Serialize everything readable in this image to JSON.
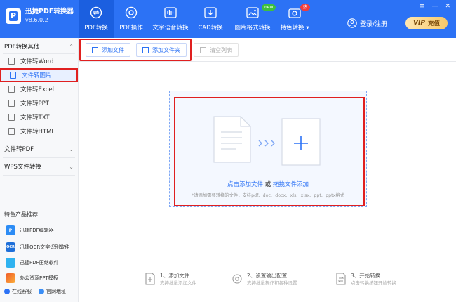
{
  "app": {
    "name": "迅捷PDF转换器",
    "version": "v8.6.0.2"
  },
  "nav": {
    "tabs": [
      {
        "label": "PDF转换",
        "active": true
      },
      {
        "label": "PDF操作"
      },
      {
        "label": "文字语音转换"
      },
      {
        "label": "CAD转换"
      },
      {
        "label": "图片格式转换",
        "badge": "new"
      },
      {
        "label": "特色转换",
        "badge": "热"
      }
    ]
  },
  "header": {
    "login_label": "登录/注册",
    "vip_mark": "VIP",
    "vip_label": "充值"
  },
  "window_controls": {
    "menu": "≡",
    "minimize": "—",
    "close": "✕"
  },
  "sidebar": {
    "section1": "PDF转换其他",
    "items": [
      {
        "label": "文件转Word"
      },
      {
        "label": "文件转图片",
        "active": true
      },
      {
        "label": "文件转Excel"
      },
      {
        "label": "文件转PPT"
      },
      {
        "label": "文件转TXT"
      },
      {
        "label": "文件转HTML"
      }
    ],
    "section2": "文件转PDF",
    "section3": "WPS文件转换",
    "featured_title": "特色产品推荐",
    "featured": [
      {
        "label": "迅捷PDF编辑器",
        "icon_label": "P"
      },
      {
        "label": "迅捷OCR文字识别软件",
        "icon_label": "OCR"
      },
      {
        "label": "迅捷PDF压缩软件",
        "icon_label": ""
      },
      {
        "label": "办公资源PPT模板",
        "icon_label": ""
      }
    ],
    "bottom": {
      "service": "在线客服",
      "website": "官网地址"
    }
  },
  "toolbar": {
    "add_file": "添加文件",
    "add_folder": "添加文件夹",
    "clear_list": "清空列表"
  },
  "dropzone": {
    "link1": "点击添加文件",
    "or": " 或 ",
    "link2": "拖拽文件添加",
    "hint": "*请添加需要转换的文件，支持pdf、doc、docx、xls、xlsx、ppt、pptx格式"
  },
  "steps": [
    {
      "title": "1、添加文件",
      "sub": "支持批量添加文件"
    },
    {
      "title": "2、设置输出配置",
      "sub": "支持批量操作和各种设置"
    },
    {
      "title": "3、开始转换",
      "sub": "点击转换按钮开始转换"
    }
  ],
  "colors": {
    "primary": "#2c72f5",
    "highlight": "#e02020",
    "vip_gold": "#f7c86a"
  }
}
